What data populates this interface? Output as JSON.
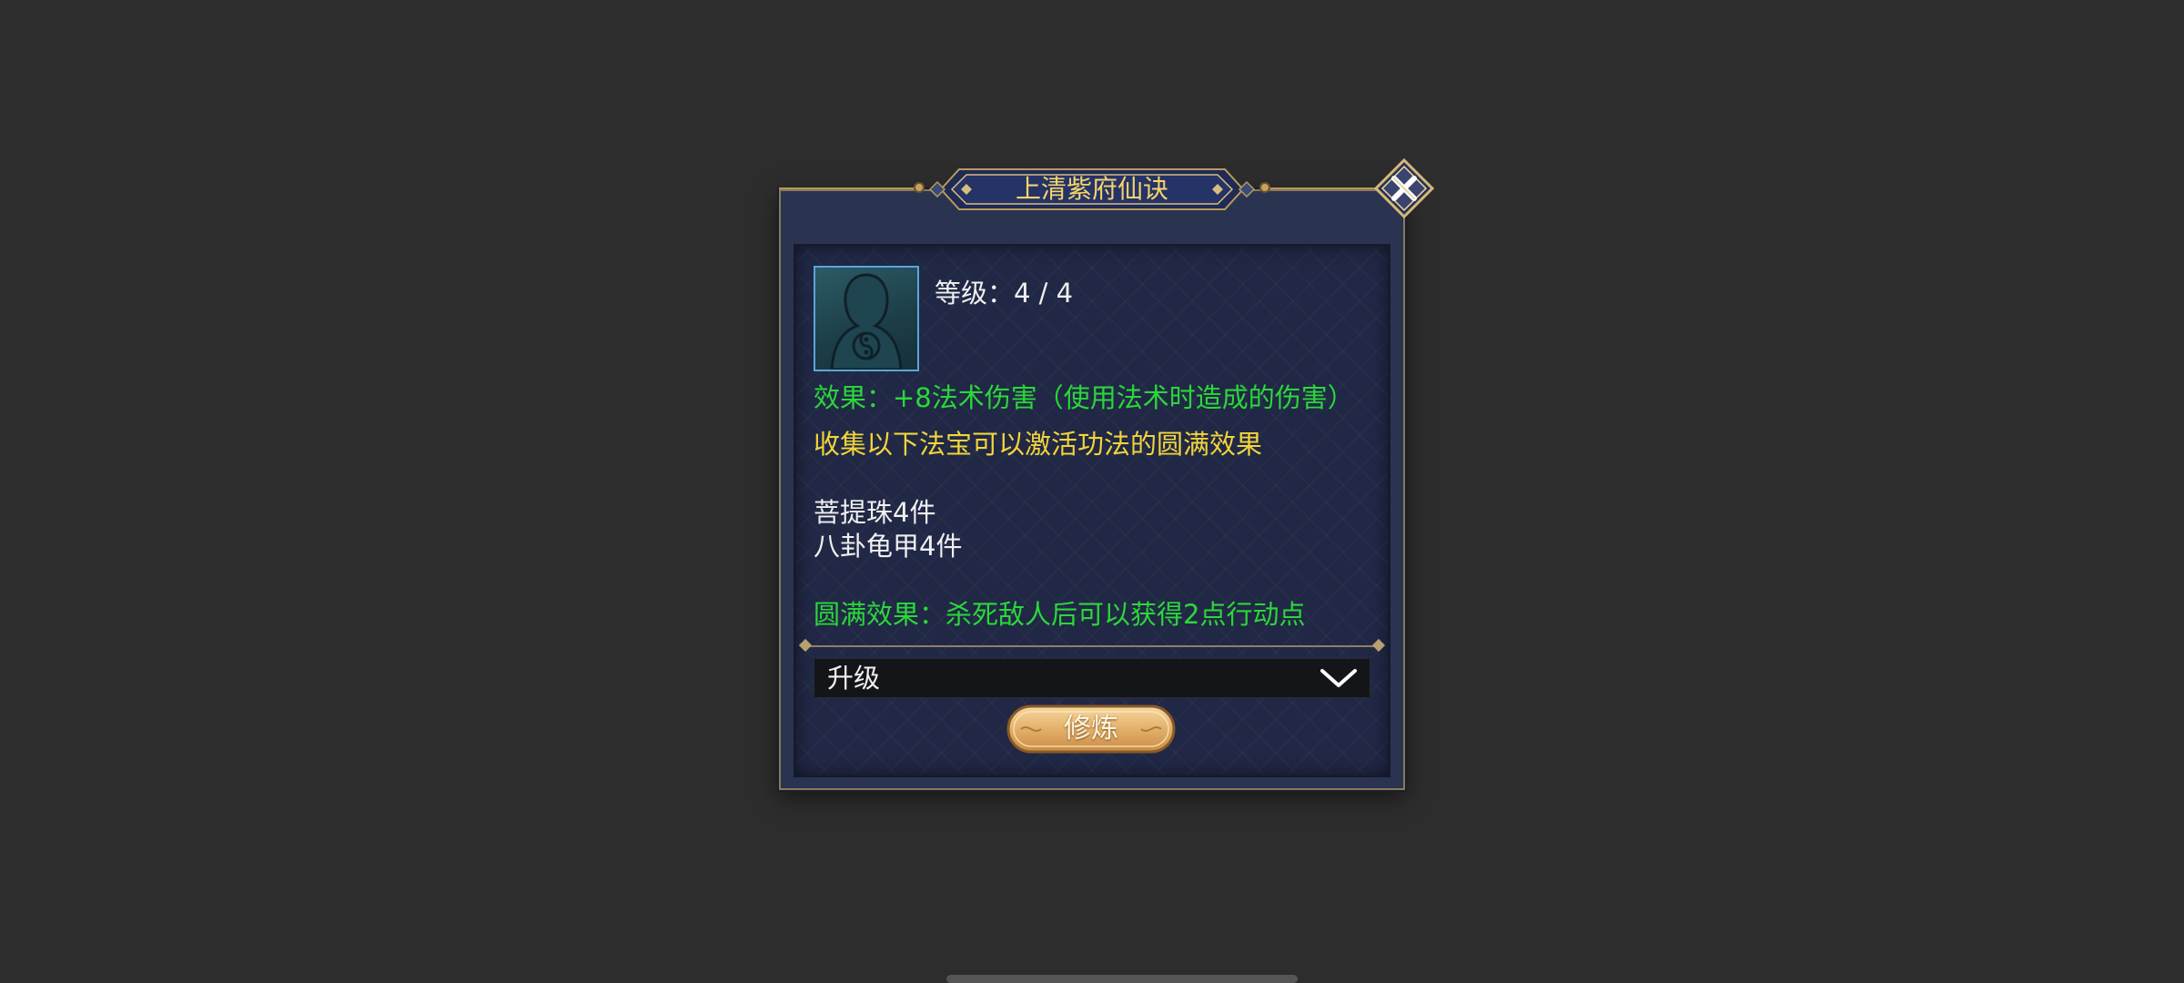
{
  "dialog": {
    "title": "上清紫府仙诀",
    "close_icon": "close-x-icon"
  },
  "skill": {
    "avatar_icon": "hooded-figure-taiji-icon",
    "level_text": "等级：4 / 4",
    "effect_text": "效果：+8法术伤害（使用法术时造成的伤害）",
    "collect_hint": "收集以下法宝可以激活功法的圆满效果",
    "required_items": [
      "菩提珠4件",
      "八卦龟甲4件"
    ],
    "perfect_effect": "圆满效果：杀死敌人后可以获得2点行动点"
  },
  "action_select": {
    "value": "升级",
    "chevron_icon": "chevron-down-icon"
  },
  "train_button": {
    "label": "修炼"
  },
  "colors": {
    "background": "#2d2d2d",
    "panel": "#202845",
    "title_gold": "#f4d56a",
    "effect_green": "#2bd73a",
    "hint_yellow": "#f2d43c",
    "button_gold": "#e8b872"
  }
}
